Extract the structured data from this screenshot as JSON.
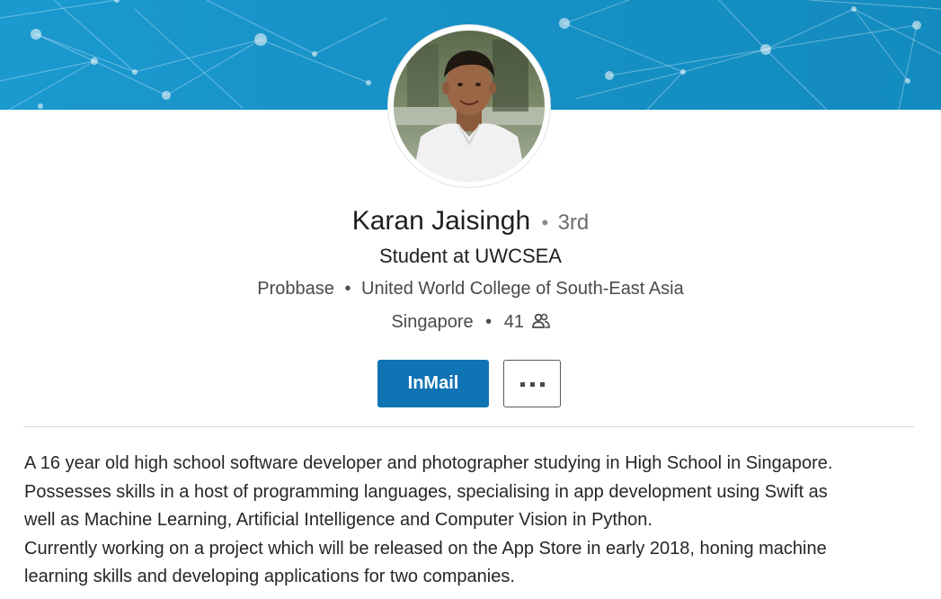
{
  "profile": {
    "name": "Karan Jaisingh",
    "degree_separator": "•",
    "degree": "3rd",
    "headline": "Student at UWCSEA",
    "company": "Probbase",
    "bullet": "•",
    "school": "United World College of South-East Asia",
    "location": "Singapore",
    "connections": "41",
    "avatar_icon": "profile-photo"
  },
  "actions": {
    "inmail_label": "InMail",
    "more_icon": "more-dots-icon"
  },
  "summary": {
    "lines": [
      "A 16 year old high school software developer and photographer studying in High School in Singapore.",
      "Possesses skills in a host of programming languages, specialising in app development using Swift as",
      "well as Machine Learning, Artificial Intelligence and Computer Vision in Python.",
      "Currently working on a project which will be released on the App Store in early 2018, honing machine",
      "learning skills and developing applications for two companies."
    ]
  },
  "colors": {
    "banner": "#1791c7",
    "primary_button": "#0f73b4",
    "text": "#262626",
    "muted": "#6e6e6e"
  }
}
